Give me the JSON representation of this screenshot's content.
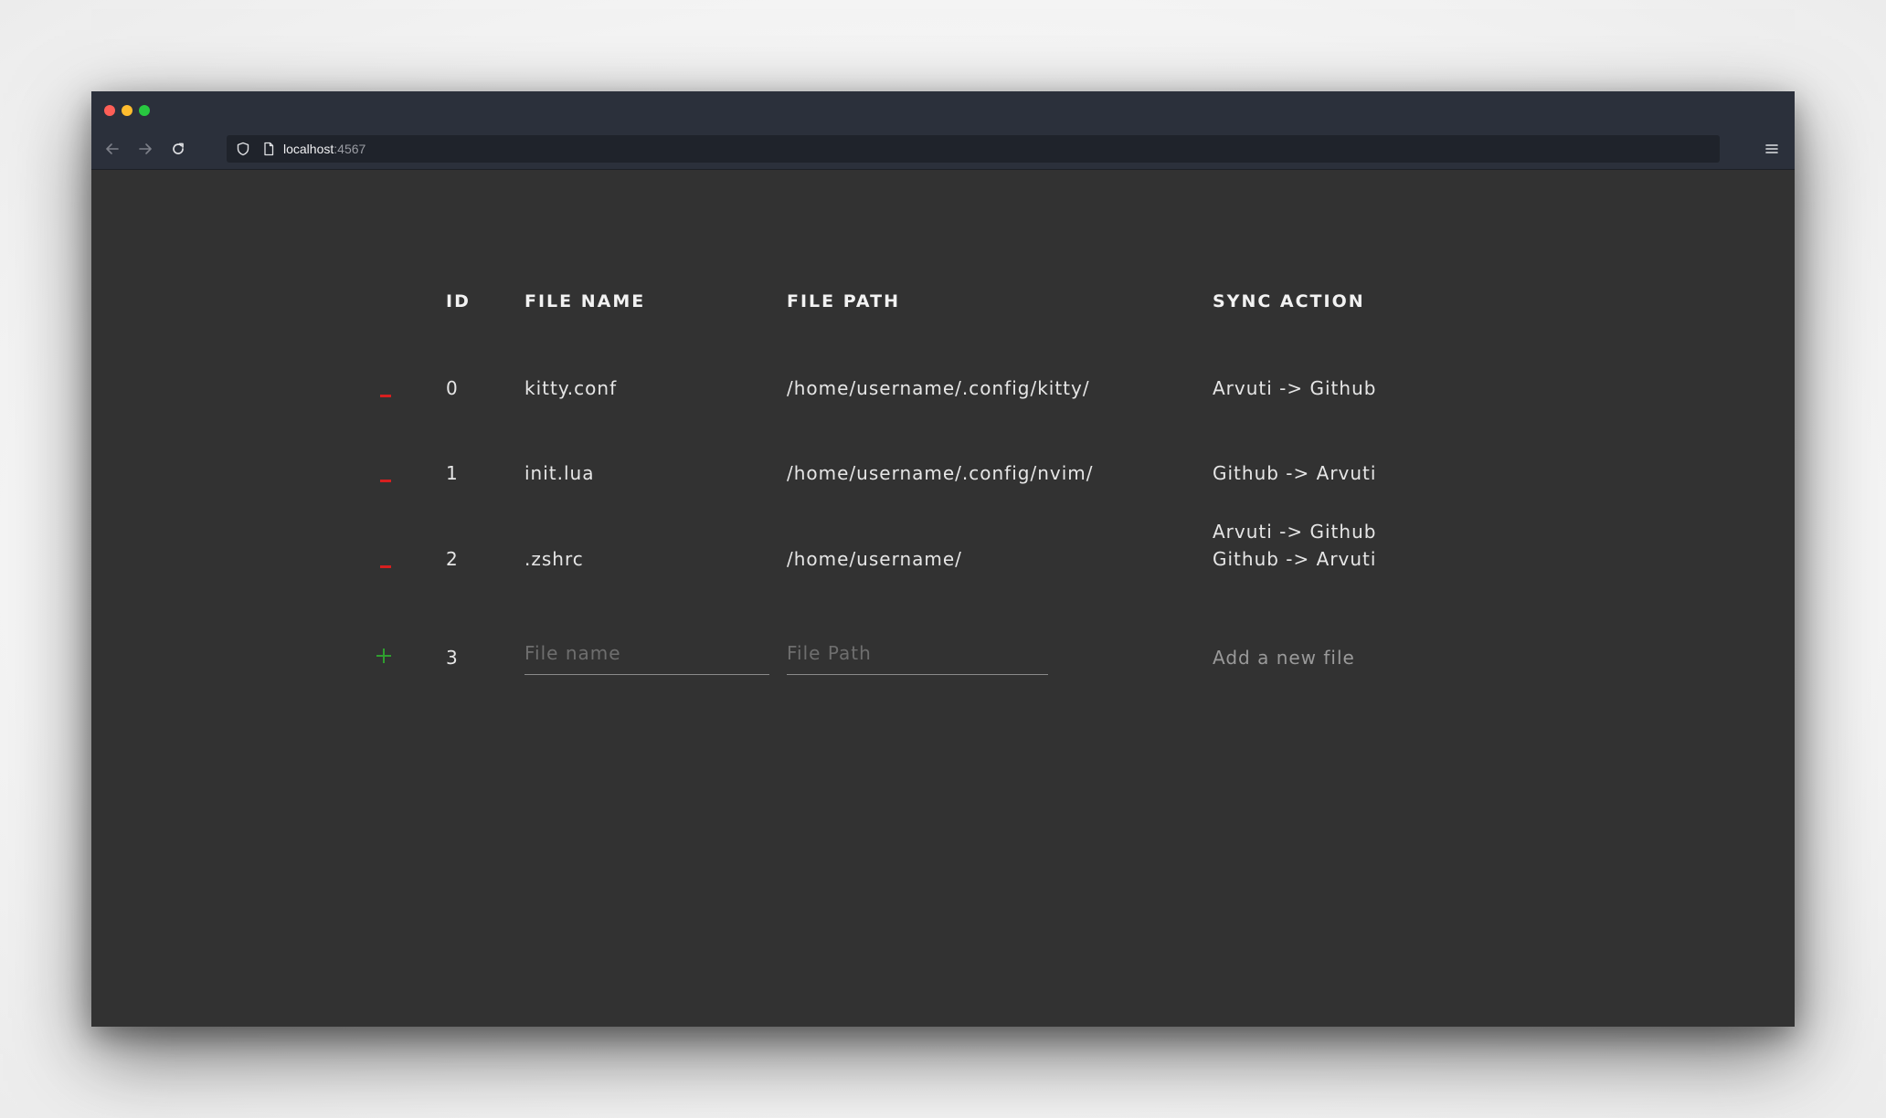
{
  "browser": {
    "url_host": "localhost",
    "url_port": ":4567"
  },
  "table": {
    "headers": {
      "id": "ID",
      "file_name": "FILE NAME",
      "file_path": "FILE PATH",
      "sync_action": "SYNC ACTION"
    },
    "rows": [
      {
        "id": "0",
        "file_name": "kitty.conf",
        "file_path": "/home/username/.config/kitty/",
        "sync_actions": [
          "Arvuti -> Github"
        ]
      },
      {
        "id": "1",
        "file_name": "init.lua",
        "file_path": "/home/username/.config/nvim/",
        "sync_actions": [
          "Github -> Arvuti"
        ]
      },
      {
        "id": "2",
        "file_name": ".zshrc",
        "file_path": "/home/username/",
        "sync_actions": [
          "Arvuti -> Github",
          "Github -> Arvuti"
        ]
      }
    ],
    "new_row": {
      "id": "3",
      "file_name_placeholder": "File name",
      "file_path_placeholder": "File Path",
      "action_label": "Add a new file"
    }
  },
  "colors": {
    "remove": "#d61f1f",
    "add": "#2f9e2f",
    "background": "#323232"
  },
  "icons": {
    "remove": "minus-icon",
    "add": "plus-icon"
  }
}
